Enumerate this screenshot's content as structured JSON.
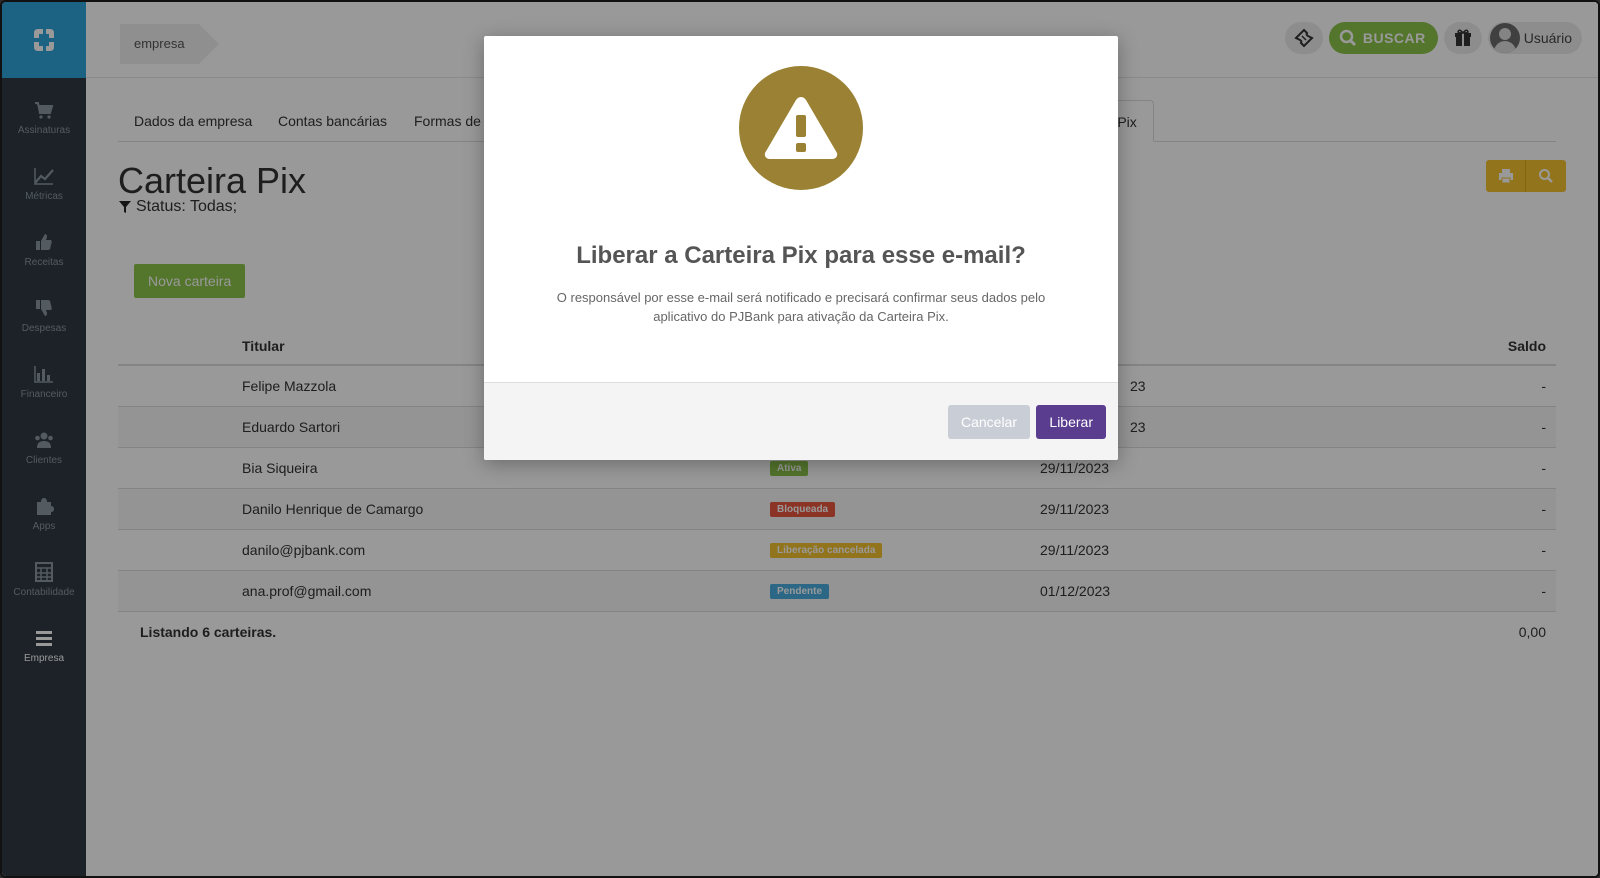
{
  "header": {
    "breadcrumb": "empresa",
    "search_label": "BUSCAR",
    "user_label": "Usuário",
    "search_color": "#8bc34a"
  },
  "sidebar": {
    "items": [
      {
        "label": "Assinaturas",
        "icon": "cart-icon"
      },
      {
        "label": "Métricas",
        "icon": "line-chart-icon"
      },
      {
        "label": "Receitas",
        "icon": "thumbs-up-icon"
      },
      {
        "label": "Despesas",
        "icon": "thumbs-down-icon"
      },
      {
        "label": "Financeiro",
        "icon": "bar-chart-icon"
      },
      {
        "label": "Clientes",
        "icon": "users-icon"
      },
      {
        "label": "Apps",
        "icon": "puzzle-icon"
      },
      {
        "label": "Contabilidade",
        "icon": "calculator-icon"
      },
      {
        "label": "Empresa",
        "icon": "menu-icon"
      }
    ],
    "active": "Empresa"
  },
  "tabs": [
    {
      "label": "Dados da empresa"
    },
    {
      "label": "Contas bancárias"
    },
    {
      "label": "Formas de"
    },
    {
      "label": "ra Pix"
    }
  ],
  "page": {
    "title": "Carteira Pix",
    "status_filter": "Status: Todas;",
    "new_button": "Nova carteira"
  },
  "table": {
    "headers": {
      "titular": "Titular",
      "saldo": "Saldo"
    },
    "rows": [
      {
        "titular": "Felipe Mazzola",
        "status": "",
        "date": "23",
        "saldo": "-"
      },
      {
        "titular": "Eduardo Sartori",
        "status": "",
        "date": "23",
        "saldo": "-"
      },
      {
        "titular": "Bia Siqueira",
        "status": "Ativa",
        "status_color": "#8bc34a",
        "date": "29/11/2023",
        "saldo": "-"
      },
      {
        "titular": "Danilo Henrique de Camargo",
        "status": "Bloqueada",
        "status_color": "#e8553f",
        "date": "29/11/2023",
        "saldo": "-"
      },
      {
        "titular": "danilo@pjbank.com",
        "status": "Liberação cancelada",
        "status_color": "#f2c12e",
        "date": "29/11/2023",
        "saldo": "-"
      },
      {
        "titular": "ana.prof@gmail.com",
        "status": "Pendente",
        "status_color": "#4aaee0",
        "date": "01/12/2023",
        "saldo": "-"
      }
    ],
    "footer_text": "Listando 6 carteiras.",
    "footer_total": "0,00"
  },
  "modal": {
    "icon": "warning-icon",
    "icon_color": "#9a8133",
    "title": "Liberar a Carteira Pix para esse e-mail?",
    "text_line1": "O responsável por esse e-mail será notificado e precisará confirmar seus dados pelo",
    "text_line2": "aplicativo do PJBank para ativação da Carteira Pix.",
    "cancel_label": "Cancelar",
    "confirm_label": "Liberar"
  }
}
